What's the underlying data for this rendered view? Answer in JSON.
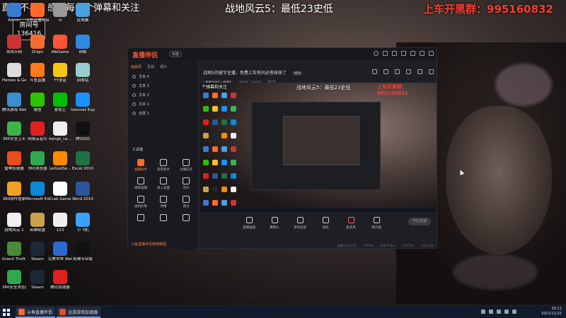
{
  "overlay": {
    "top_left_text": "直播不易，感谢每一个弹幕和关注",
    "title": "战地风云5：最低23史低",
    "qq_group": "上车开黑群：995160832",
    "room_label": "房间号",
    "room_number": "136416"
  },
  "desktop_icons": [
    {
      "label": "Admin",
      "color": "#3a7bd5"
    },
    {
      "label": "斗鱼直播伴侣",
      "color": "#ff6a2a"
    },
    {
      "label": "ni",
      "color": "#999"
    },
    {
      "label": "此电脑",
      "color": "#4aa0e0"
    },
    {
      "label": "央视天网",
      "color": "#c33"
    },
    {
      "label": "Origin",
      "color": "#f56c2d"
    },
    {
      "label": "WeGame",
      "color": "#ff5533"
    },
    {
      "label": "网络",
      "color": "#2d8ae0"
    },
    {
      "label": "Heroes & Generals",
      "color": "#ddd"
    },
    {
      "label": "斗鱼直播",
      "color": "#ff7a1a"
    },
    {
      "label": "YY语音",
      "color": "#f5c518"
    },
    {
      "label": "回收站",
      "color": "#9cc"
    },
    {
      "label": "腾讯游戏 WeGame版",
      "color": "#3a8fd0"
    },
    {
      "label": "微信",
      "color": "#2dc100"
    },
    {
      "label": "爱奇艺",
      "color": "#00be06"
    },
    {
      "label": "Internet Explorer",
      "color": "#1e90ff"
    },
    {
      "label": "360安全卫士",
      "color": "#3bb54a"
    },
    {
      "label": "网易云音乐",
      "color": "#e02020"
    },
    {
      "label": "bongo_ca...",
      "color": "#eee"
    },
    {
      "label": "腾讯QQ",
      "color": "#111"
    },
    {
      "label": "雷神加速器",
      "color": "#e94e1b"
    },
    {
      "label": "360浏览器",
      "color": "#2fa84f"
    },
    {
      "label": "LeiGodSe...",
      "color": "#ff8a00"
    },
    {
      "label": "Excel 2010",
      "color": "#1f7244"
    },
    {
      "label": "360软件管家",
      "color": "#f0a020"
    },
    {
      "label": "Microsoft Edge",
      "color": "#0c88d8"
    },
    {
      "label": "Crab Game",
      "color": "#fff"
    },
    {
      "label": "Word 2010",
      "color": "#2b579a"
    },
    {
      "label": "战地风云 1",
      "color": "#eee"
    },
    {
      "label": "英雄联盟",
      "color": "#c8a24a"
    },
    {
      "label": "123",
      "color": "#eee"
    },
    {
      "label": "小飞机",
      "color": "#3aa0ff"
    },
    {
      "label": "Grand Theft Auto V",
      "color": "#4a8a3a"
    },
    {
      "label": "Steam",
      "color": "#1b2838"
    },
    {
      "label": "完美世界 WeGame版",
      "color": "#2d6ad0"
    },
    {
      "label": "剪映专业版",
      "color": "#111"
    },
    {
      "label": "360安全浏览器",
      "color": "#2fa84f"
    },
    {
      "label": "Steam",
      "color": "#1b2838"
    },
    {
      "label": "腾讯加速器",
      "color": "#e02020"
    }
  ],
  "app": {
    "logo": "直播伴侣",
    "tag": "桌面",
    "tabs": [
      "画面源",
      "互动",
      "观众"
    ],
    "sources": [
      "文本 4",
      "文本 3",
      "文本 2",
      "文本 1",
      "全屏 1"
    ],
    "tools_title": "工具箱",
    "tools": [
      "直播助手",
      "房管助手",
      "主播任务",
      "视频直播",
      "录入设置",
      "音乐",
      "虚拟形象",
      "弹幕",
      "歌词",
      "",
      "",
      ""
    ],
    "notice": "斗鱼直播伴侣使用教程",
    "announcement": "战地5的留字主播，免费上车有问必答球球了",
    "announce_edit": "修改",
    "meta_pill": "战地2042 - 战地5",
    "meta_room": "房间号 136416",
    "meta_fans": "5079",
    "preview_title": "战地风云5：最低23史低",
    "preview_qq": "上车开黑群：995160832",
    "preview_scroll": "个弹幕和关注",
    "controls": [
      "直播画面",
      "摄像头",
      "手机投屏",
      "录屏",
      "麦克风",
      "扬声器"
    ],
    "start_label": "开始直播",
    "status": [
      "直播时长00:00",
      "FPS:60",
      "码率:0kbps",
      "CPU:5%",
      "内存:23%"
    ]
  },
  "taskbar": {
    "items": [
      {
        "label": "斗鱼直播伴侣",
        "color": "#ff6a2a"
      },
      {
        "label": "迅游游戏加速器",
        "color": "#e94e1b"
      }
    ],
    "time": "20:11",
    "date": "2021/11/15"
  }
}
